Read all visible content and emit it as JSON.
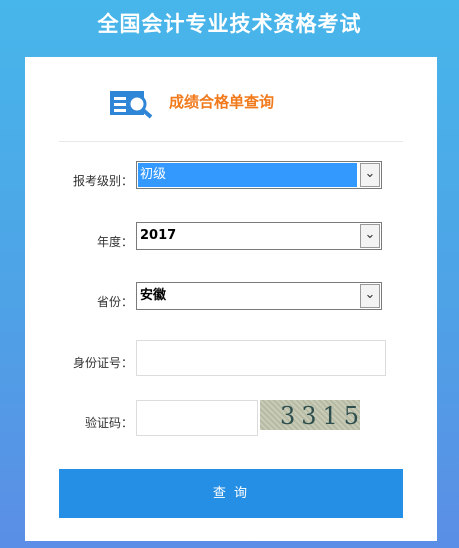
{
  "header": {
    "title": "全国会计专业技术资格考试"
  },
  "panel": {
    "subtitle": "成绩合格单查询"
  },
  "form": {
    "level_label": "报考级别：",
    "level_value": "初级",
    "year_label": "年度：",
    "year_value": "2017",
    "province_label": "省份：",
    "province_value": "安徽",
    "id_label": "身份证号：",
    "id_value": "",
    "captcha_label": "验证码：",
    "captcha_value": "",
    "captcha_text": "3315"
  },
  "actions": {
    "query_label": "查 询"
  },
  "colors": {
    "accent": "#258ee5",
    "subtitle": "#f07a1c"
  },
  "icons": {
    "select_arrow": "chevron-down-icon",
    "logo": "search-doc-icon"
  }
}
